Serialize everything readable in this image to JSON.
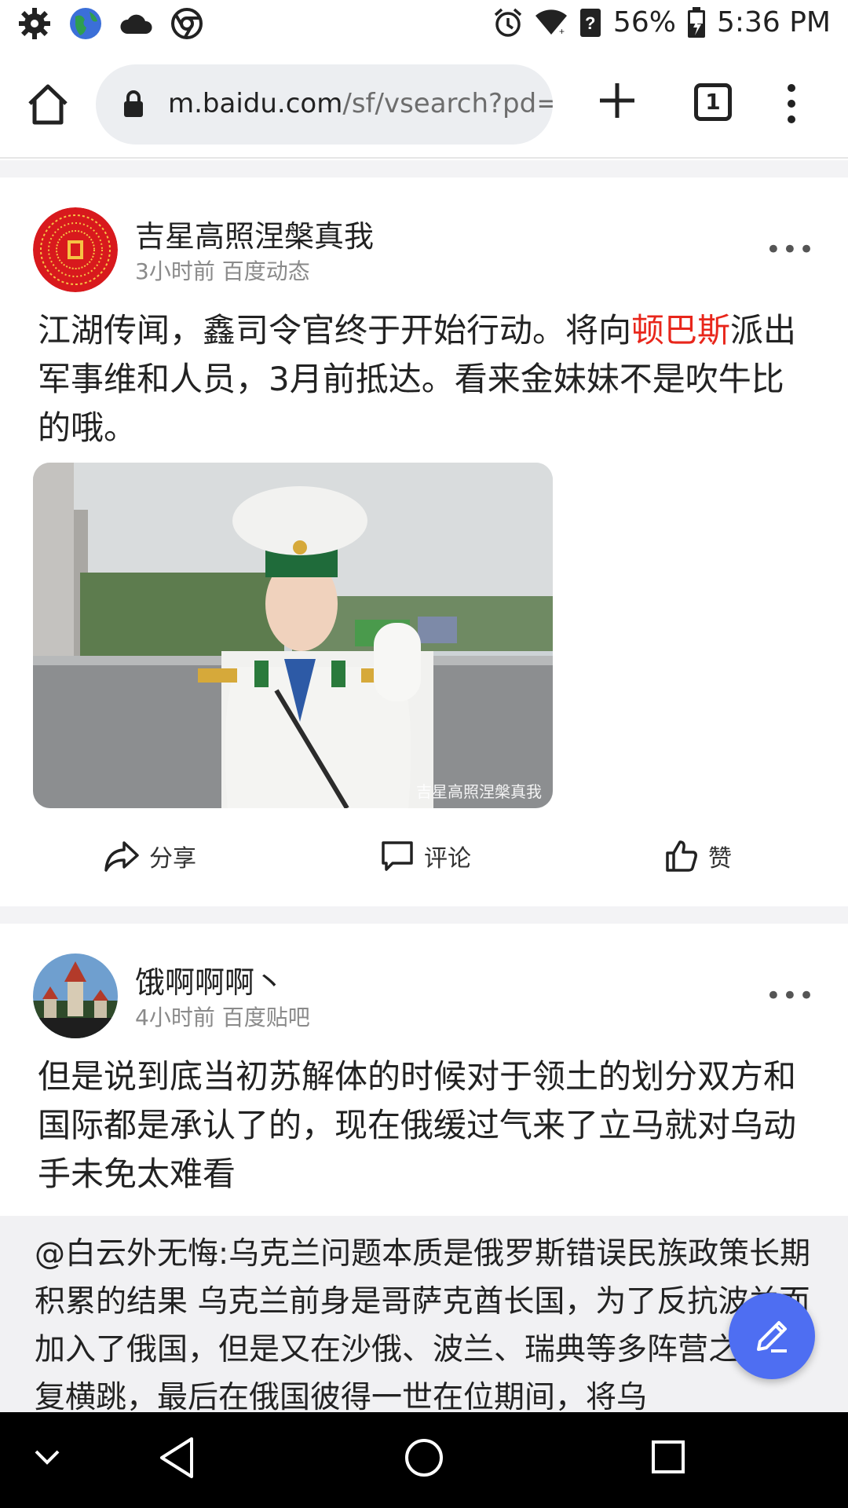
{
  "status_bar": {
    "battery": "56%",
    "time": "5:36 PM"
  },
  "browser": {
    "url_host": "m.baidu.com",
    "url_path": "/sf/vsearch?pd=r",
    "tab_count": "1"
  },
  "posts": [
    {
      "author": "吉星高照涅槃真我",
      "time": "3小时前",
      "source": "百度动态",
      "more": "•••",
      "text_before": "江湖传闻，鑫司令官终于开始行动。将向",
      "text_highlight": "顿巴斯",
      "text_after": "派出军事维和人员，3月前抵达。看来金妹妹不是吹牛比的哦。",
      "image_watermark": "吉星高照涅槃真我",
      "actions": {
        "share": "分享",
        "comment": "评论",
        "like": "赞"
      }
    },
    {
      "author": "饿啊啊啊丶",
      "time": "4小时前",
      "source": "百度贴吧",
      "more": "•••",
      "text": "但是说到底当初苏解体的时候对于领土的划分双方和国际都是承认了的，现在俄缓过气来了立马就对乌动手未免太难看",
      "quote": "@白云外无悔:乌克兰问题本质是俄罗斯错误民族政策长期积累的结果 乌克兰前身是哥萨克酋长国，为了反抗波兰而加入了俄国，但是又在沙俄、波兰、瑞典等多阵营之间反复横跳，最后在俄国彼得一世在位期间，将乌"
    }
  ]
}
